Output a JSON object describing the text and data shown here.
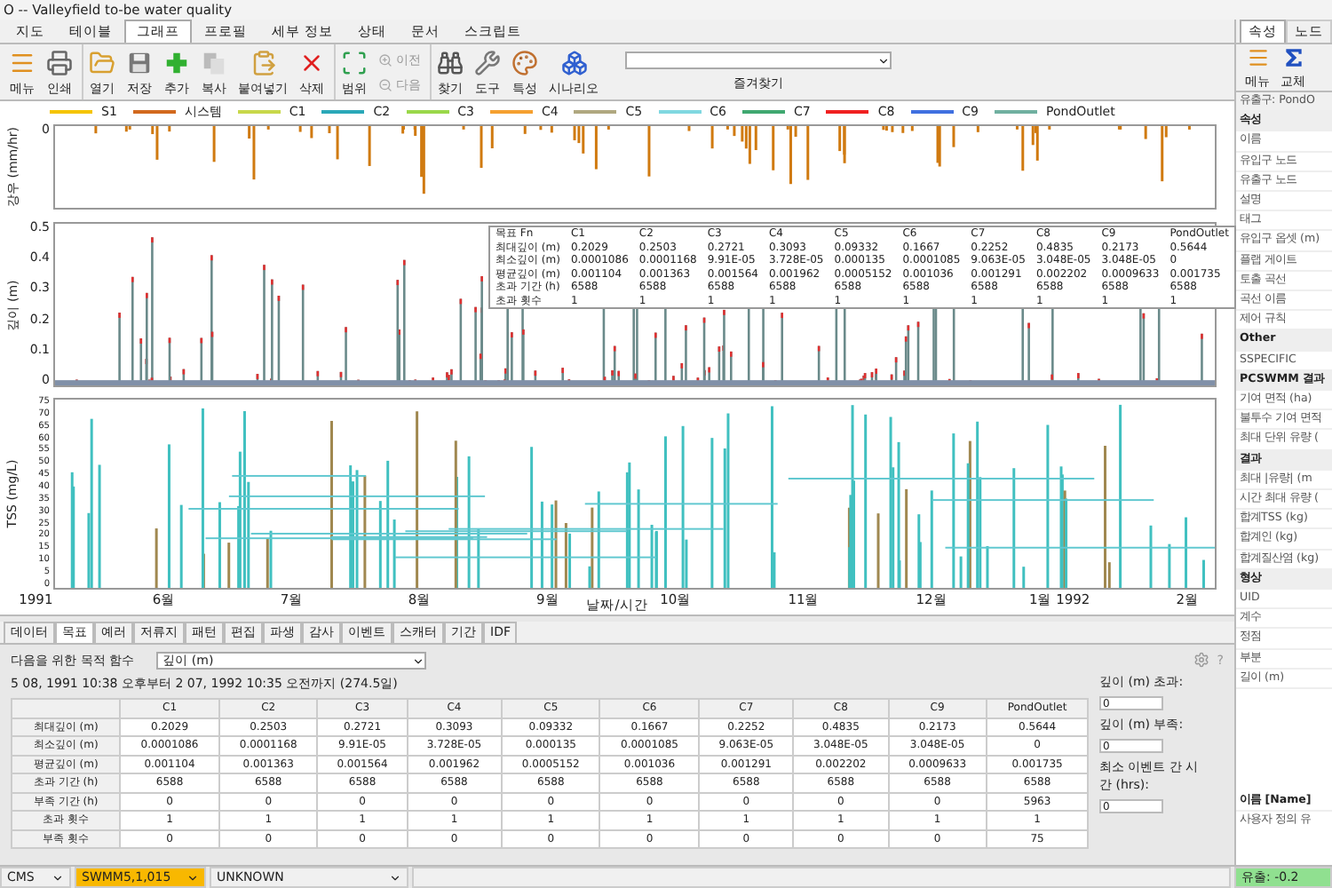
{
  "window": {
    "title": "O -- Valleyfield to-be water quality"
  },
  "menu_tabs": [
    {
      "label": "지도",
      "selected": false
    },
    {
      "label": "테이블",
      "selected": false
    },
    {
      "label": "그래프",
      "selected": true
    },
    {
      "label": "프로필",
      "selected": false
    },
    {
      "label": "세부 정보",
      "selected": false
    },
    {
      "label": "상태",
      "selected": false
    },
    {
      "label": "문서",
      "selected": false
    },
    {
      "label": "스크립트",
      "selected": false
    }
  ],
  "toolbar": {
    "items": [
      {
        "label": "메뉴",
        "kind": "big"
      },
      {
        "label": "인쇄",
        "kind": "big"
      },
      {
        "label": "열기",
        "kind": "big",
        "sep": true
      },
      {
        "label": "저장",
        "kind": "big"
      },
      {
        "label": "추가",
        "kind": "big"
      },
      {
        "label": "복사",
        "kind": "big"
      },
      {
        "label": "붙여넣기",
        "kind": "big"
      },
      {
        "label": "삭제",
        "kind": "big"
      },
      {
        "label": "범위",
        "kind": "big",
        "sep": true
      },
      {
        "label": "이전",
        "kind": "small"
      },
      {
        "label": "다음",
        "kind": "small"
      },
      {
        "label": "찾기",
        "kind": "big",
        "sep": true
      },
      {
        "label": "도구",
        "kind": "big"
      },
      {
        "label": "특성",
        "kind": "big"
      },
      {
        "label": "시나리오",
        "kind": "big"
      }
    ],
    "favorites": {
      "label": "즐겨찾기"
    }
  },
  "chart": {
    "legend": [
      {
        "name": "S1",
        "color": "#f5c400"
      },
      {
        "name": "시스템",
        "color": "#d2691e"
      },
      {
        "name": "C1",
        "color": "#c8d84a"
      },
      {
        "name": "C2",
        "color": "#2aa8b8"
      },
      {
        "name": "C3",
        "color": "#9ad84a"
      },
      {
        "name": "C4",
        "color": "#f5a030"
      },
      {
        "name": "C5",
        "color": "#b0a880"
      },
      {
        "name": "C6",
        "color": "#80d8e0"
      },
      {
        "name": "C7",
        "color": "#40a870"
      },
      {
        "name": "C8",
        "color": "#f02020"
      },
      {
        "name": "C9",
        "color": "#4070e0"
      },
      {
        "name": "PondOutlet",
        "color": "#70b0a0"
      }
    ],
    "panels": [
      {
        "kind": "rain",
        "ylabel": "강우 (mm/hr)",
        "yticks": [
          "0"
        ]
      },
      {
        "kind": "depth",
        "ylabel": "깊이 (m)",
        "yticks": [
          "0.5",
          "0.4",
          "0.3",
          "0.2",
          "0.1",
          "0"
        ]
      },
      {
        "kind": "tss",
        "ylabel": "TSS (mg/L)",
        "yticks": [
          "75",
          "70",
          "65",
          "60",
          "55",
          "50",
          "45",
          "40",
          "35",
          "30",
          "25",
          "20",
          "15",
          "10",
          "5",
          "0"
        ]
      }
    ],
    "xticks": [
      "1991",
      "6월",
      "7월",
      "8월",
      "9월",
      "10월",
      "11월",
      "12월",
      "1월 1992",
      "2월"
    ],
    "xlabel": "날짜/시간",
    "summary": {
      "corner": "목표 Fn",
      "columns": [
        "C1",
        "C2",
        "C3",
        "C4",
        "C5",
        "C6",
        "C7",
        "C8",
        "C9",
        "PondOutlet"
      ],
      "rows": [
        {
          "label": "최대깊이 (m)",
          "cells": [
            "0.2029",
            "0.2503",
            "0.2721",
            "0.3093",
            "0.09332",
            "0.1667",
            "0.2252",
            "0.4835",
            "0.2173",
            "0.5644"
          ]
        },
        {
          "label": "최소깊이 (m)",
          "cells": [
            "0.0001086",
            "0.0001168",
            "9.91E-05",
            "3.728E-05",
            "0.000135",
            "0.0001085",
            "9.063E-05",
            "3.048E-05",
            "3.048E-05",
            "0"
          ]
        },
        {
          "label": "평균깊이 (m)",
          "cells": [
            "0.001104",
            "0.001363",
            "0.001564",
            "0.001962",
            "0.0005152",
            "0.001036",
            "0.001291",
            "0.002202",
            "0.0009633",
            "0.001735"
          ]
        },
        {
          "label": "초과 기간 (h)",
          "cells": [
            "6588",
            "6588",
            "6588",
            "6588",
            "6588",
            "6588",
            "6588",
            "6588",
            "6588",
            "6588"
          ]
        },
        {
          "label": "초과 횟수",
          "cells": [
            "1",
            "1",
            "1",
            "1",
            "1",
            "1",
            "1",
            "1",
            "1",
            "1"
          ]
        }
      ]
    }
  },
  "bottom": {
    "tabs": [
      {
        "label": "데이터",
        "selected": false
      },
      {
        "label": "목표",
        "selected": true
      },
      {
        "label": "예러",
        "selected": false
      },
      {
        "label": "저류지",
        "selected": false
      },
      {
        "label": "패턴",
        "selected": false
      },
      {
        "label": "편집",
        "selected": false
      },
      {
        "label": "파생",
        "selected": false
      },
      {
        "label": "감사",
        "selected": false
      },
      {
        "label": "이벤트",
        "selected": false
      },
      {
        "label": "스캐터",
        "selected": false
      },
      {
        "label": "기간",
        "selected": false
      },
      {
        "label": "IDF",
        "selected": false
      }
    ],
    "objective_label": "다음을 위한 목적 함수",
    "objective_value": "깊이 (m)",
    "period": "5 08, 1991 10:38 오후부터 2 07, 1992 10:35 오전까지 (274.5일)",
    "table": {
      "columns": [
        "C1",
        "C2",
        "C3",
        "C4",
        "C5",
        "C6",
        "C7",
        "C8",
        "C9",
        "PondOutlet"
      ],
      "rows": [
        {
          "label": "최대깊이 (m)",
          "cells": [
            "0.2029",
            "0.2503",
            "0.2721",
            "0.3093",
            "0.09332",
            "0.1667",
            "0.2252",
            "0.4835",
            "0.2173",
            "0.5644"
          ]
        },
        {
          "label": "최소깊이 (m)",
          "cells": [
            "0.0001086",
            "0.0001168",
            "9.91E-05",
            "3.728E-05",
            "0.000135",
            "0.0001085",
            "9.063E-05",
            "3.048E-05",
            "3.048E-05",
            "0"
          ]
        },
        {
          "label": "평균깊이 (m)",
          "cells": [
            "0.001104",
            "0.001363",
            "0.001564",
            "0.001962",
            "0.0005152",
            "0.001036",
            "0.001291",
            "0.002202",
            "0.0009633",
            "0.001735"
          ]
        },
        {
          "label": "초과 기간 (h)",
          "cells": [
            "6588",
            "6588",
            "6588",
            "6588",
            "6588",
            "6588",
            "6588",
            "6588",
            "6588",
            "6588"
          ]
        },
        {
          "label": "부족 기간 (h)",
          "cells": [
            "0",
            "0",
            "0",
            "0",
            "0",
            "0",
            "0",
            "0",
            "0",
            "5963"
          ]
        },
        {
          "label": "초과 횟수",
          "cells": [
            "1",
            "1",
            "1",
            "1",
            "1",
            "1",
            "1",
            "1",
            "1",
            "1"
          ]
        },
        {
          "label": "부족 횟수",
          "cells": [
            "0",
            "0",
            "0",
            "0",
            "0",
            "0",
            "0",
            "0",
            "0",
            "75"
          ]
        }
      ]
    },
    "help": "?",
    "settings": [
      {
        "label": "깊이 (m) 초과:",
        "value": "0"
      },
      {
        "label": "깊이 (m) 부족:",
        "value": "0"
      },
      {
        "label": "최소 이벤트 간 시간 (hrs):",
        "value": "0"
      }
    ]
  },
  "properties": {
    "tabs": [
      {
        "label": "속성",
        "selected": true
      },
      {
        "label": "노드",
        "selected": false
      }
    ],
    "tools": [
      "메뉴",
      "교체"
    ],
    "header": "유출구: PondO",
    "items": [
      {
        "label": "속성",
        "kind": "section"
      },
      {
        "label": "이름",
        "kind": "item"
      },
      {
        "label": "유입구 노드",
        "kind": "item"
      },
      {
        "label": "유출구 노드",
        "kind": "item"
      },
      {
        "label": "설명",
        "kind": "item"
      },
      {
        "label": "태그",
        "kind": "item"
      },
      {
        "label": "유입구 옵셋 (m)",
        "kind": "item"
      },
      {
        "label": "플랩 게이트",
        "kind": "item"
      },
      {
        "label": "토출 곡선",
        "kind": "item"
      },
      {
        "label": "곡선 이름",
        "kind": "item"
      },
      {
        "label": "제어 규칙",
        "kind": "item"
      },
      {
        "label": "Other",
        "kind": "section"
      },
      {
        "label": "SSPECIFIC",
        "kind": "item"
      },
      {
        "label": "PCSWMM 결과",
        "kind": "section"
      },
      {
        "label": "기여 면적 (ha)",
        "kind": "item"
      },
      {
        "label": "불투수 기여 면적",
        "kind": "item"
      },
      {
        "label": "최대 단위 유량 (",
        "kind": "item"
      },
      {
        "label": "결과",
        "kind": "section"
      },
      {
        "label": "최대 |유량| (m",
        "kind": "item"
      },
      {
        "label": "시간 최대 유량 (",
        "kind": "item"
      },
      {
        "label": "합계TSS (kg)",
        "kind": "item"
      },
      {
        "label": "합계인 (kg)",
        "kind": "item"
      },
      {
        "label": "합계질산염 (kg)",
        "kind": "item"
      },
      {
        "label": "형상",
        "kind": "section"
      },
      {
        "label": "UID",
        "kind": "item"
      },
      {
        "label": "계수",
        "kind": "item"
      },
      {
        "label": "정점",
        "kind": "item"
      },
      {
        "label": "부분",
        "kind": "item"
      },
      {
        "label": "길이 (m)",
        "kind": "item"
      }
    ],
    "description": {
      "title": "이름 [Name]",
      "text": "사용자 정의 유"
    }
  },
  "status_bar": {
    "units": "CMS",
    "engine": "SWMM5,1,015",
    "projection": "UNKNOWN",
    "flow": "유출: -0.2"
  }
}
